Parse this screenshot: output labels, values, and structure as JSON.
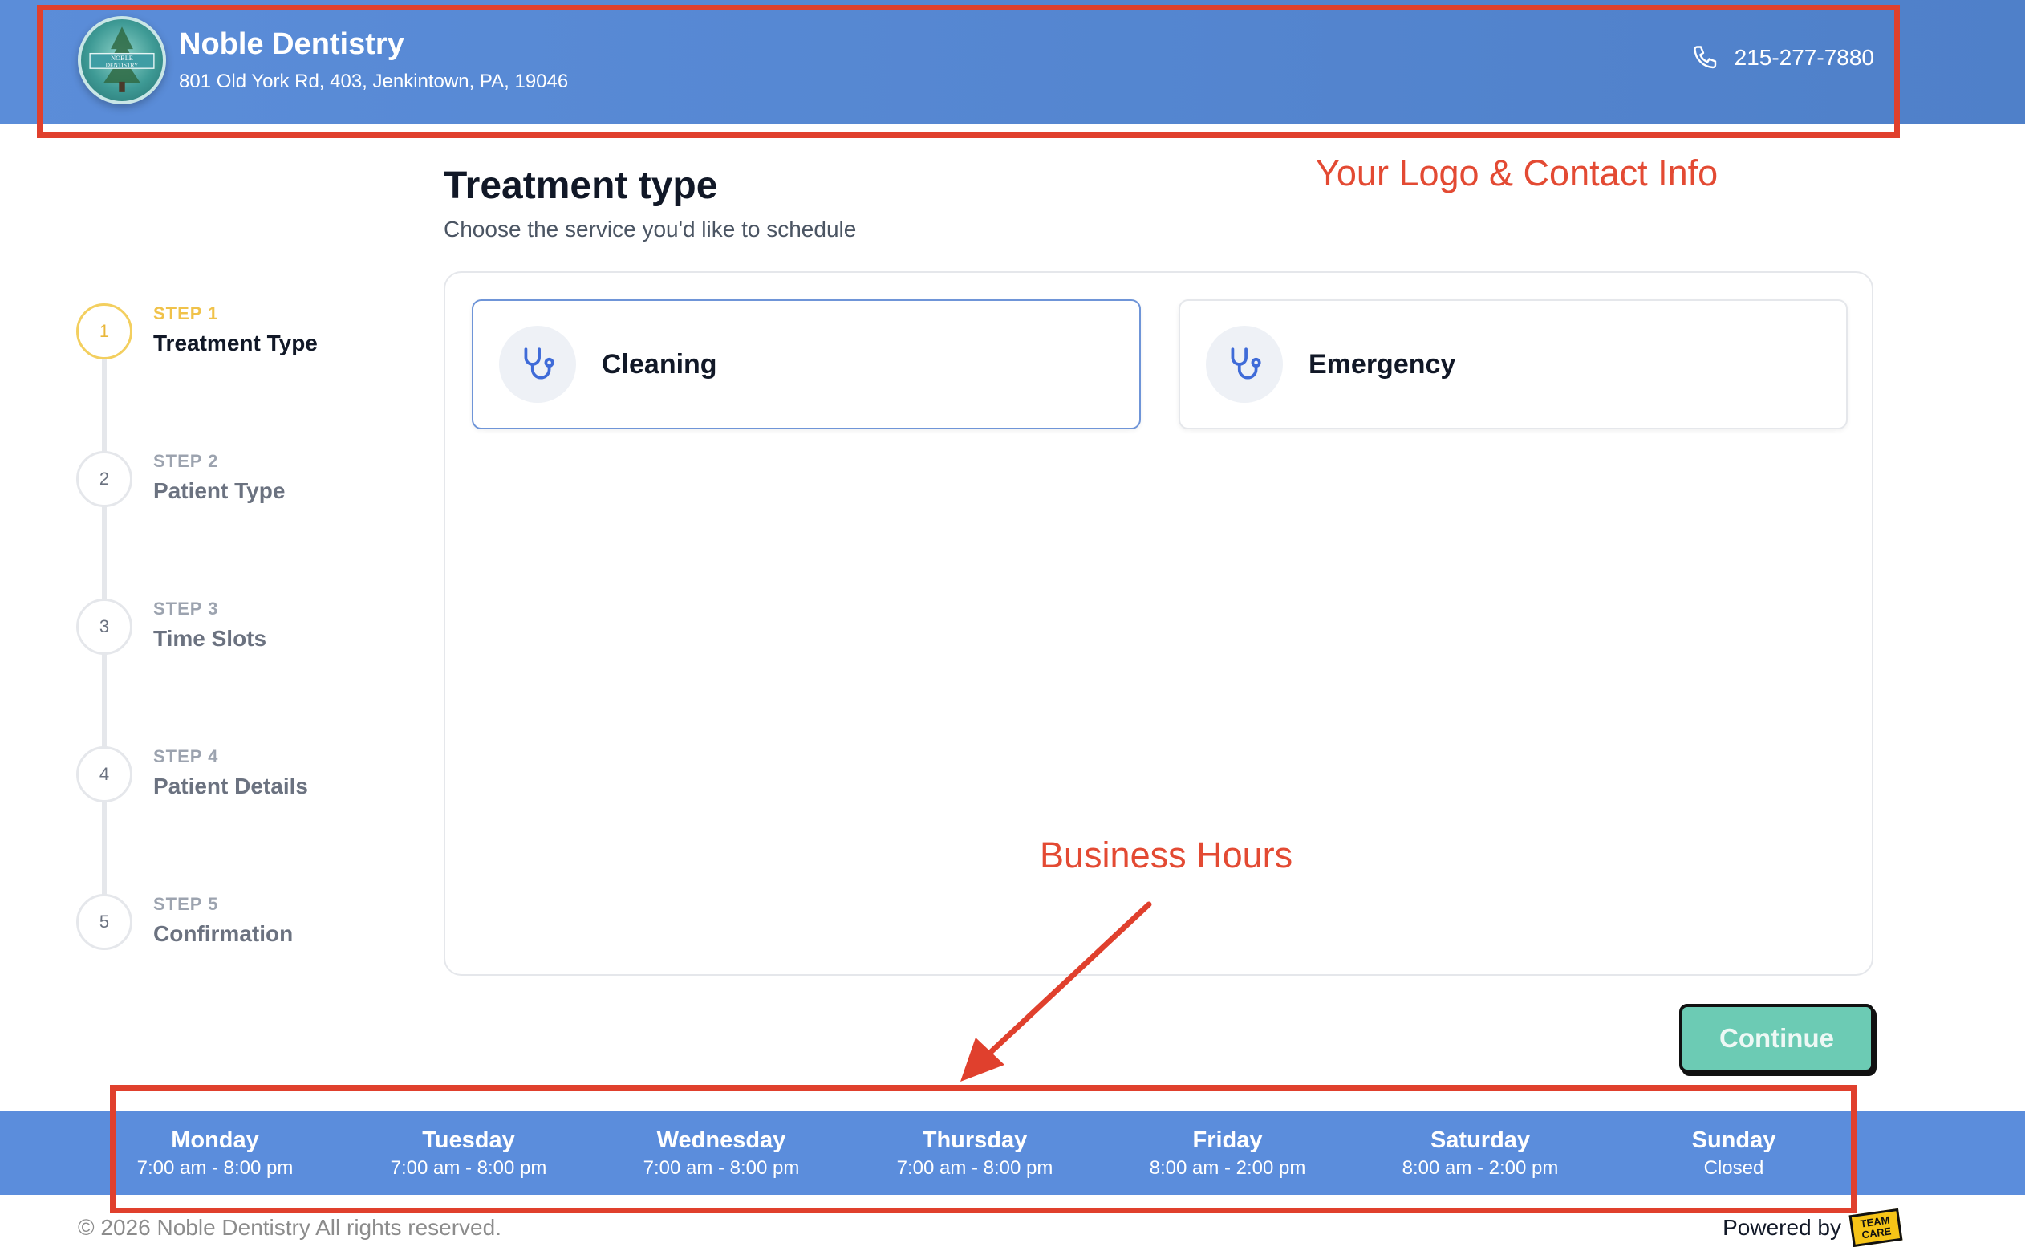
{
  "header": {
    "brand_name": "Noble Dentistry",
    "address": "801 Old York Rd, 403, Jenkintown, PA, 19046",
    "logo_text": "NOBLE DENTISTRY",
    "phone": "215-277-7880",
    "phone_icon": "phone-icon",
    "background_color": "#5b8dd9"
  },
  "annotations": {
    "logo_contact": "Your Logo & Contact Info",
    "business_hours": "Business Hours",
    "color": "#e0402d"
  },
  "stepper": {
    "steps": [
      {
        "number": "1",
        "kicker": "STEP 1",
        "title": "Treatment Type",
        "active": true
      },
      {
        "number": "2",
        "kicker": "STEP 2",
        "title": "Patient Type",
        "active": false
      },
      {
        "number": "3",
        "kicker": "STEP 3",
        "title": "Time Slots",
        "active": false
      },
      {
        "number": "4",
        "kicker": "STEP 4",
        "title": "Patient Details",
        "active": false
      },
      {
        "number": "5",
        "kicker": "STEP 5",
        "title": "Confirmation",
        "active": false
      }
    ],
    "active_color": "#f0c24a"
  },
  "main": {
    "title": "Treatment type",
    "subtitle": "Choose the service you'd like to schedule",
    "options": [
      {
        "label": "Cleaning",
        "icon": "stethoscope-icon",
        "selected": true
      },
      {
        "label": "Emergency",
        "icon": "stethoscope-icon",
        "selected": false
      }
    ],
    "continue_label": "Continue",
    "continue_color": "#6ccbb4"
  },
  "hours": [
    {
      "day": "Monday",
      "hours": "7:00 am - 8:00 pm"
    },
    {
      "day": "Tuesday",
      "hours": "7:00 am - 8:00 pm"
    },
    {
      "day": "Wednesday",
      "hours": "7:00 am - 8:00 pm"
    },
    {
      "day": "Thursday",
      "hours": "7:00 am - 8:00 pm"
    },
    {
      "day": "Friday",
      "hours": "8:00 am - 2:00 pm"
    },
    {
      "day": "Saturday",
      "hours": "8:00 am - 2:00 pm"
    },
    {
      "day": "Sunday",
      "hours": "Closed"
    }
  ],
  "footer": {
    "copyright": "© 2026 Noble Dentistry All rights reserved.",
    "powered_by": "Powered by",
    "powered_logo_text": "TEAM CARE"
  }
}
